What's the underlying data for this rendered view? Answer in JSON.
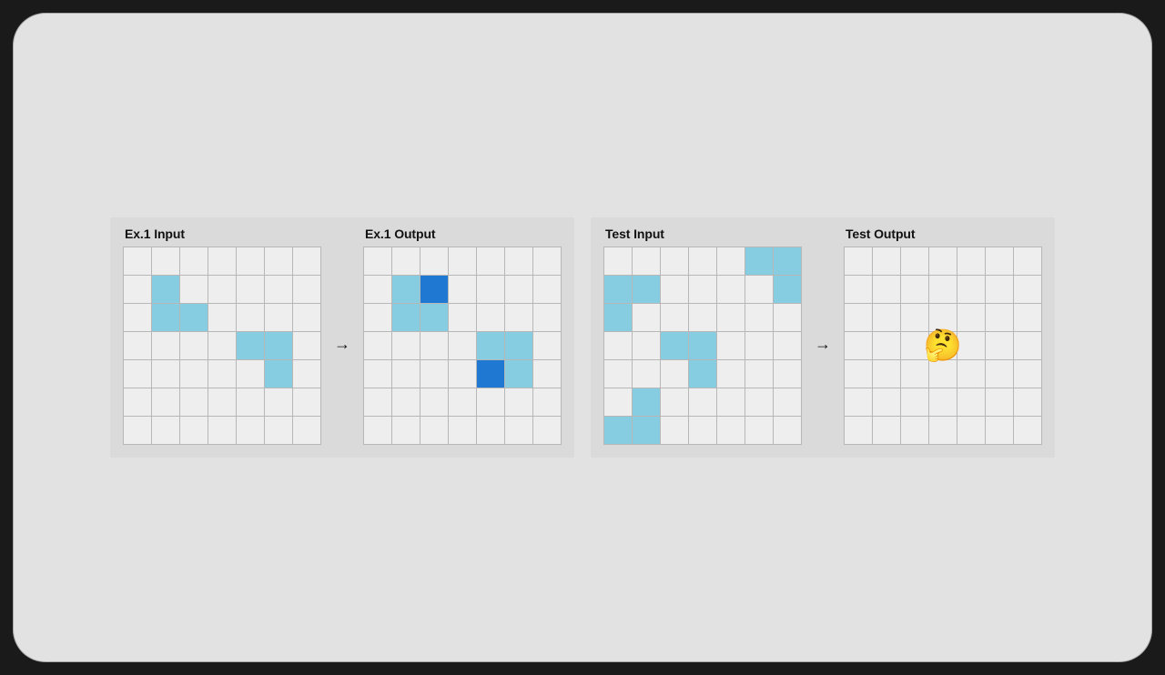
{
  "grid": {
    "rows": 7,
    "cols": 7
  },
  "colors": {
    "light": "#86cde2",
    "dark": "#1f78d1",
    "empty": "#eeeeee",
    "gridline": "#b7b7b7",
    "panel_bg": "#dadada",
    "screen_bg": "#e2e2e2"
  },
  "arrow_glyph": "→",
  "emoji": "🤔",
  "example": {
    "input": {
      "title": "Ex.1 Input",
      "cells": [
        {
          "r": 1,
          "c": 1,
          "k": "light"
        },
        {
          "r": 2,
          "c": 1,
          "k": "light"
        },
        {
          "r": 2,
          "c": 2,
          "k": "light"
        },
        {
          "r": 3,
          "c": 4,
          "k": "light"
        },
        {
          "r": 3,
          "c": 5,
          "k": "light"
        },
        {
          "r": 4,
          "c": 5,
          "k": "light"
        }
      ]
    },
    "output": {
      "title": "Ex.1 Output",
      "cells": [
        {
          "r": 1,
          "c": 1,
          "k": "light"
        },
        {
          "r": 1,
          "c": 2,
          "k": "dark"
        },
        {
          "r": 2,
          "c": 1,
          "k": "light"
        },
        {
          "r": 2,
          "c": 2,
          "k": "light"
        },
        {
          "r": 3,
          "c": 4,
          "k": "light"
        },
        {
          "r": 3,
          "c": 5,
          "k": "light"
        },
        {
          "r": 4,
          "c": 4,
          "k": "dark"
        },
        {
          "r": 4,
          "c": 5,
          "k": "light"
        }
      ]
    }
  },
  "test": {
    "input": {
      "title": "Test Input",
      "cells": [
        {
          "r": 0,
          "c": 5,
          "k": "light"
        },
        {
          "r": 0,
          "c": 6,
          "k": "light"
        },
        {
          "r": 1,
          "c": 0,
          "k": "light"
        },
        {
          "r": 1,
          "c": 1,
          "k": "light"
        },
        {
          "r": 1,
          "c": 6,
          "k": "light"
        },
        {
          "r": 2,
          "c": 0,
          "k": "light"
        },
        {
          "r": 3,
          "c": 2,
          "k": "light"
        },
        {
          "r": 3,
          "c": 3,
          "k": "light"
        },
        {
          "r": 4,
          "c": 3,
          "k": "light"
        },
        {
          "r": 5,
          "c": 1,
          "k": "light"
        },
        {
          "r": 6,
          "c": 0,
          "k": "light"
        },
        {
          "r": 6,
          "c": 1,
          "k": "light"
        }
      ]
    },
    "output": {
      "title": "Test Output",
      "cells": [],
      "overlay_emoji": true
    }
  }
}
